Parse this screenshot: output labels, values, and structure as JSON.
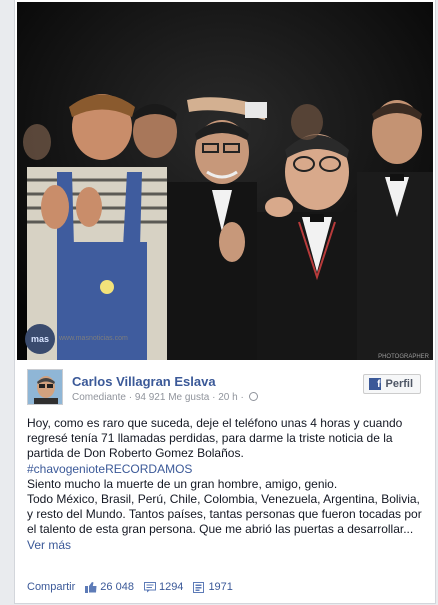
{
  "photo": {
    "logo_text": "mas",
    "caption": "www.masnoticias.com",
    "credit": "PHOTOGRAPHER"
  },
  "post": {
    "author": "Carlos Villagran Eslava",
    "category": "Comediante",
    "likes_page": "94 921 Me gusta",
    "separator": "·",
    "time": "20 h",
    "profile_button": "Perfil",
    "text_line1": "Hoy, como es raro que suceda, deje el teléfono unas 4 horas y cuando regresé tenía 71 llamadas perdidas, para darme la triste noticia de la partida de Don Roberto Gomez Bolaños.",
    "hashtag": "#chavogenioteRECORDAMOS",
    "text_line2": "Siento mucho la muerte de un gran hombre, amigo, genio.",
    "text_line3": "Todo México, Brasil, Perú, Chile, Colombia, Venezuela, Argentina, Bolivia, y resto del Mundo. Tantos países, tantas personas que fueron tocadas por el talento de esta gran persona. Que me abrió las puertas a desarrollar...",
    "see_more": "Ver más"
  },
  "footer": {
    "share": "Compartir",
    "likes": "26 048",
    "comments": "1294",
    "shares": "1971"
  },
  "colors": {
    "link": "#3b5998",
    "meta": "#90949c"
  }
}
